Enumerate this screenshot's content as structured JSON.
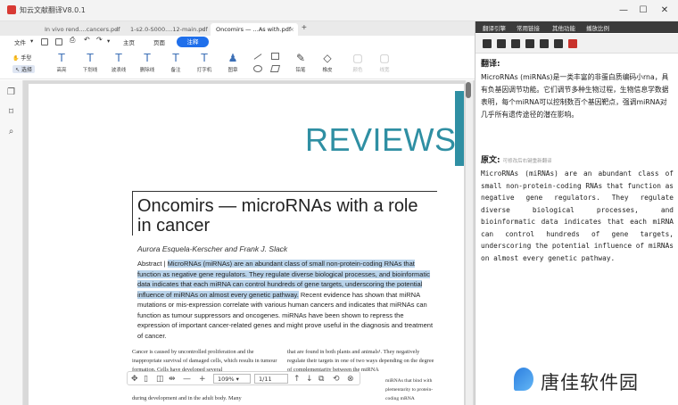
{
  "window": {
    "title": "知云文献翻译V8.0.1",
    "controls": [
      "—",
      "☐",
      "✕"
    ]
  },
  "tabs": [
    {
      "label": "In vivo rend....cancers.pdf",
      "active": false
    },
    {
      "label": "1-s2.0-S000....12-main.pdf",
      "active": false
    },
    {
      "label": "Oncomirs — ...As with.pdf",
      "active": true
    }
  ],
  "tab_add": "+",
  "menu": {
    "file": "文件",
    "home": "主页",
    "page": "页面",
    "annotate": "注释"
  },
  "toolbar": {
    "hand": "手型",
    "select": "选择",
    "tools": [
      {
        "label": "高亮",
        "glyph": "T"
      },
      {
        "label": "下划线",
        "glyph": "T"
      },
      {
        "label": "波浪线",
        "glyph": "T"
      },
      {
        "label": "删除线",
        "glyph": "T"
      },
      {
        "label": "备注",
        "glyph": "T"
      },
      {
        "label": "打字机",
        "glyph": "T"
      },
      {
        "label": "图章",
        "glyph": "♟"
      },
      {
        "label": "铅笔",
        "glyph": "✎"
      },
      {
        "label": "橡皮",
        "glyph": "◇"
      },
      {
        "label": "颜色",
        "glyph": "▢"
      },
      {
        "label": "线宽",
        "glyph": "▢"
      }
    ]
  },
  "document": {
    "header": "REVIEWS",
    "title": "Oncomirs — microRNAs with a role in cancer",
    "authors": "Aurora Esquela-Kerscher and Frank J. Slack",
    "abstract_label": "Abstract | ",
    "abstract_highlight": "MicroRNAs (miRNAs) are an abundant class of small non-protein-coding RNAs that function as negative gene regulators. They regulate diverse biological processes, and bioinformatic data indicates that each miRNA can control hundreds of gene targets, underscoring the potential influence of miRNAs on almost every genetic pathway.",
    "abstract_rest": " Recent evidence has shown that miRNA mutations or mis-expression correlate with various human cancers and indicates that miRNAs can function as tumour suppressors and oncogenes. miRNAs have been shown to repress the expression of important cancer-related genes and might prove useful in the diagnosis and treatment of cancer.",
    "col1": "Cancer is caused by uncontrolled proliferation and the inappropriate survival of damaged cells, which results in tumour formation. Cells have developed several",
    "col1_tail": "during development and in the adult body. Many",
    "col2": "that are found in both plants and animals¹. They negatively regulate their targets in one of two ways depending on the degree of complementarity between the miRNA",
    "col2_tail": "miRNAs that bind with plementarity to protein- coding mRNA sequences induce the RNA-mediated"
  },
  "bottom_bar": {
    "zoom": "109%",
    "page": "1/11"
  },
  "right_panel": {
    "tabs": [
      "翻译引擎",
      "常用链接",
      "其他功能",
      "播放比例"
    ],
    "translation_title": "翻译:",
    "translation": "MicroRNAs (miRNAs)是一类丰富的非蛋白质编码小rna，具有负基因调节功能。它们调节多种生物过程，生物信息学数据表明，每个miRNA可以控制数百个基因靶点，强调miRNA对几乎所有遗传途径的潜在影响。",
    "original_title": "原文:",
    "original_hint": "可修改后右键重新翻译",
    "original": "MicroRNAs (miRNAs) are an abundant class of small non-protein-coding RNAs that function as negative gene regulators. They regulate diverse biological processes, and bioinformatic data indicates that each miRNA can control hundreds of gene targets, underscoring the potential influence of miRNAs on almost every genetic pathway."
  },
  "watermark": "唐佳软件园",
  "colors": {
    "accent": "#1f6feb",
    "reviews_teal": "#2f8fa3",
    "highlight": "#b9d3ea",
    "panel_header": "#3b3b3b",
    "red_icon": "#c8322c"
  }
}
